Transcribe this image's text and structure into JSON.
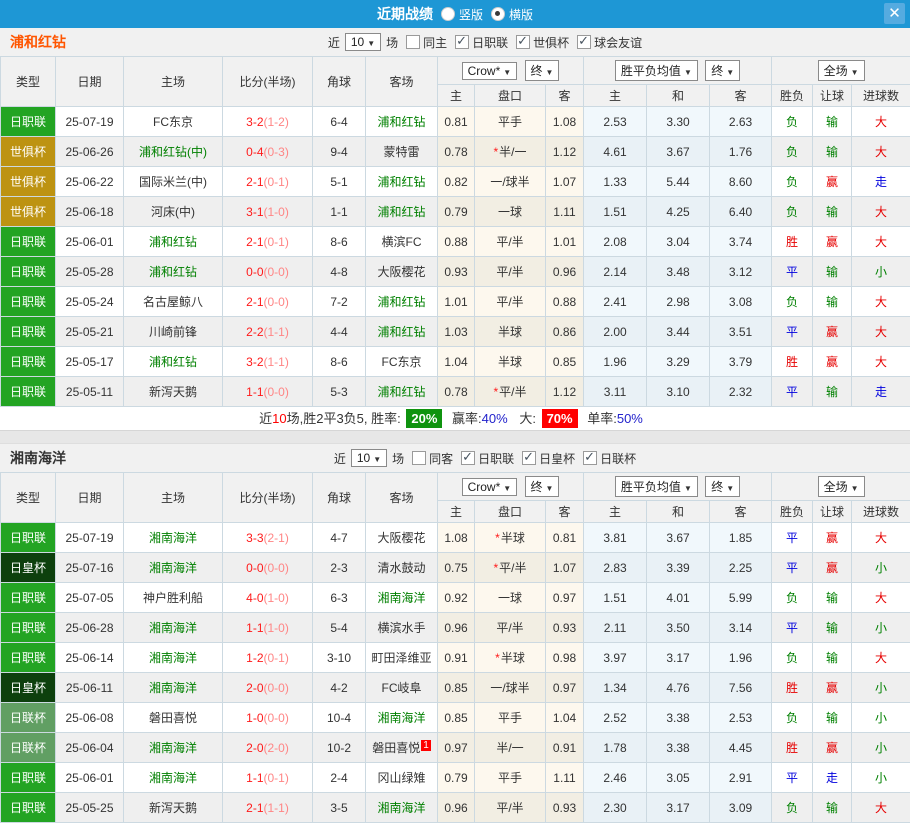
{
  "titlebar": {
    "title": "近期战绩",
    "radio_vertical": "竖版",
    "radio_horizontal": "横版",
    "close_label": "✕"
  },
  "table_header": {
    "cols": [
      "类型",
      "日期",
      "主场",
      "比分(半场)",
      "角球",
      "客场"
    ],
    "odds_dropdown": "Crow*",
    "final_dropdown": "终",
    "avg_dropdown": "胜平负均值",
    "avg_final_dropdown": "终",
    "scope_dropdown": "全场",
    "sub_cols": [
      "主",
      "盘口",
      "客",
      "主",
      "和",
      "客",
      "胜负",
      "让球",
      "进球数"
    ]
  },
  "league_colors": {
    "日职联": "#23a423",
    "世俱杯": "#bd9312",
    "日皇杯": "#0d400d",
    "日联杯": "#619f63"
  },
  "result_colors": {
    "r": "#e60000",
    "g": "#008000",
    "b": "#0000dd"
  },
  "accent_colors": {
    "titlebar": "#1e97d5",
    "team1": "#ff5500",
    "team2": "#333333",
    "win_badge_bg": "#0f930f",
    "big_badge_bg": "#ff0000"
  },
  "sections": [
    {
      "team": "浦和红钻",
      "filter": {
        "near_label": "近",
        "count": "10",
        "games_label": "场",
        "same_label": "同主",
        "same_checked": false,
        "leagues": [
          {
            "label": "日职联",
            "checked": true
          },
          {
            "label": "世俱杯",
            "checked": true
          },
          {
            "label": "球会友谊",
            "checked": true
          }
        ]
      },
      "rows": [
        {
          "type": "日职联",
          "date": "25-07-19",
          "home": "FC东京",
          "home_focus": false,
          "score": "3-2",
          "half": "(1-2)",
          "corner": "6-4",
          "away": "浦和红钻",
          "away_focus": true,
          "o1": "0.81",
          "pan": "平手",
          "pan_star": false,
          "o2": "1.08",
          "a1": "2.53",
          "a2": "3.30",
          "a3": "2.63",
          "r1": "负",
          "r1c": "g",
          "r2": "输",
          "r2c": "g",
          "r3": "大",
          "r3c": "r"
        },
        {
          "type": "世俱杯",
          "date": "25-06-26",
          "home": "浦和红钻(中)",
          "home_focus": true,
          "score": "0-4",
          "half": "(0-3)",
          "corner": "9-4",
          "away": "蒙特雷",
          "away_focus": false,
          "o1": "0.78",
          "pan": "半/一",
          "pan_star": true,
          "o2": "1.12",
          "a1": "4.61",
          "a2": "3.67",
          "a3": "1.76",
          "r1": "负",
          "r1c": "g",
          "r2": "输",
          "r2c": "g",
          "r3": "大",
          "r3c": "r"
        },
        {
          "type": "世俱杯",
          "date": "25-06-22",
          "home": "国际米兰(中)",
          "home_focus": false,
          "score": "2-1",
          "half": "(0-1)",
          "corner": "5-1",
          "away": "浦和红钻",
          "away_focus": true,
          "o1": "0.82",
          "pan": "一/球半",
          "pan_star": false,
          "o2": "1.07",
          "a1": "1.33",
          "a2": "5.44",
          "a3": "8.60",
          "r1": "负",
          "r1c": "g",
          "r2": "赢",
          "r2c": "r",
          "r3": "走",
          "r3c": "b"
        },
        {
          "type": "世俱杯",
          "date": "25-06-18",
          "home": "河床(中)",
          "home_focus": false,
          "score": "3-1",
          "half": "(1-0)",
          "corner": "1-1",
          "away": "浦和红钻",
          "away_focus": true,
          "o1": "0.79",
          "pan": "一球",
          "pan_star": false,
          "o2": "1.11",
          "a1": "1.51",
          "a2": "4.25",
          "a3": "6.40",
          "r1": "负",
          "r1c": "g",
          "r2": "输",
          "r2c": "g",
          "r3": "大",
          "r3c": "r"
        },
        {
          "type": "日职联",
          "date": "25-06-01",
          "home": "浦和红钻",
          "home_focus": true,
          "score": "2-1",
          "half": "(0-1)",
          "corner": "8-6",
          "away": "横滨FC",
          "away_focus": false,
          "o1": "0.88",
          "pan": "平/半",
          "pan_star": false,
          "o2": "1.01",
          "a1": "2.08",
          "a2": "3.04",
          "a3": "3.74",
          "r1": "胜",
          "r1c": "r",
          "r2": "赢",
          "r2c": "r",
          "r3": "大",
          "r3c": "r"
        },
        {
          "type": "日职联",
          "date": "25-05-28",
          "home": "浦和红钻",
          "home_focus": true,
          "score": "0-0",
          "half": "(0-0)",
          "corner": "4-8",
          "away": "大阪樱花",
          "away_focus": false,
          "o1": "0.93",
          "pan": "平/半",
          "pan_star": false,
          "o2": "0.96",
          "a1": "2.14",
          "a2": "3.48",
          "a3": "3.12",
          "r1": "平",
          "r1c": "b",
          "r2": "输",
          "r2c": "g",
          "r3": "小",
          "r3c": "g"
        },
        {
          "type": "日职联",
          "date": "25-05-24",
          "home": "名古屋鲸八",
          "home_focus": false,
          "score": "2-1",
          "half": "(0-0)",
          "corner": "7-2",
          "away": "浦和红钻",
          "away_focus": true,
          "o1": "1.01",
          "pan": "平/半",
          "pan_star": false,
          "o2": "0.88",
          "a1": "2.41",
          "a2": "2.98",
          "a3": "3.08",
          "r1": "负",
          "r1c": "g",
          "r2": "输",
          "r2c": "g",
          "r3": "大",
          "r3c": "r"
        },
        {
          "type": "日职联",
          "date": "25-05-21",
          "home": "川崎前锋",
          "home_focus": false,
          "score": "2-2",
          "half": "(1-1)",
          "corner": "4-4",
          "away": "浦和红钻",
          "away_focus": true,
          "o1": "1.03",
          "pan": "半球",
          "pan_star": false,
          "o2": "0.86",
          "a1": "2.00",
          "a2": "3.44",
          "a3": "3.51",
          "r1": "平",
          "r1c": "b",
          "r2": "赢",
          "r2c": "r",
          "r3": "大",
          "r3c": "r"
        },
        {
          "type": "日职联",
          "date": "25-05-17",
          "home": "浦和红钻",
          "home_focus": true,
          "score": "3-2",
          "half": "(1-1)",
          "corner": "8-6",
          "away": "FC东京",
          "away_focus": false,
          "o1": "1.04",
          "pan": "半球",
          "pan_star": false,
          "o2": "0.85",
          "a1": "1.96",
          "a2": "3.29",
          "a3": "3.79",
          "r1": "胜",
          "r1c": "r",
          "r2": "赢",
          "r2c": "r",
          "r3": "大",
          "r3c": "r"
        },
        {
          "type": "日职联",
          "date": "25-05-11",
          "home": "新泻天鹅",
          "home_focus": false,
          "score": "1-1",
          "half": "(0-0)",
          "corner": "5-3",
          "away": "浦和红钻",
          "away_focus": true,
          "o1": "0.78",
          "pan": "平/半",
          "pan_star": true,
          "o2": "1.12",
          "a1": "3.11",
          "a2": "3.10",
          "a3": "2.32",
          "r1": "平",
          "r1c": "b",
          "r2": "输",
          "r2c": "g",
          "r3": "走",
          "r3c": "b"
        }
      ],
      "summary": {
        "seg1": "近",
        "count": "10",
        "seg2": "场,胜2平3负5, 胜率:",
        "win_badge": "20%",
        "seg3": "赢率:",
        "win_pct": "40%",
        "seg4": "大:",
        "big_badge": "70%",
        "seg5": "单率:",
        "single_pct": "50%"
      }
    },
    {
      "team": "湘南海洋",
      "filter": {
        "near_label": "近",
        "count": "10",
        "games_label": "场",
        "same_label": "同客",
        "same_checked": false,
        "leagues": [
          {
            "label": "日职联",
            "checked": true
          },
          {
            "label": "日皇杯",
            "checked": true
          },
          {
            "label": "日联杯",
            "checked": true
          }
        ]
      },
      "rows": [
        {
          "type": "日职联",
          "date": "25-07-19",
          "home": "湘南海洋",
          "home_focus": true,
          "score": "3-3",
          "half": "(2-1)",
          "corner": "4-7",
          "away": "大阪樱花",
          "away_focus": false,
          "o1": "1.08",
          "pan": "半球",
          "pan_star": true,
          "o2": "0.81",
          "a1": "3.81",
          "a2": "3.67",
          "a3": "1.85",
          "r1": "平",
          "r1c": "b",
          "r2": "赢",
          "r2c": "r",
          "r3": "大",
          "r3c": "r"
        },
        {
          "type": "日皇杯",
          "date": "25-07-16",
          "home": "湘南海洋",
          "home_focus": true,
          "score": "0-0",
          "half": "(0-0)",
          "corner": "2-3",
          "away": "清水鼓动",
          "away_focus": false,
          "o1": "0.75",
          "pan": "平/半",
          "pan_star": true,
          "o2": "1.07",
          "a1": "2.83",
          "a2": "3.39",
          "a3": "2.25",
          "r1": "平",
          "r1c": "b",
          "r2": "赢",
          "r2c": "r",
          "r3": "小",
          "r3c": "g"
        },
        {
          "type": "日职联",
          "date": "25-07-05",
          "home": "神户胜利船",
          "home_focus": false,
          "score": "4-0",
          "half": "(1-0)",
          "corner": "6-3",
          "away": "湘南海洋",
          "away_focus": true,
          "o1": "0.92",
          "pan": "一球",
          "pan_star": false,
          "o2": "0.97",
          "a1": "1.51",
          "a2": "4.01",
          "a3": "5.99",
          "r1": "负",
          "r1c": "g",
          "r2": "输",
          "r2c": "g",
          "r3": "大",
          "r3c": "r"
        },
        {
          "type": "日职联",
          "date": "25-06-28",
          "home": "湘南海洋",
          "home_focus": true,
          "score": "1-1",
          "half": "(1-0)",
          "corner": "5-4",
          "away": "横滨水手",
          "away_focus": false,
          "o1": "0.96",
          "pan": "平/半",
          "pan_star": false,
          "o2": "0.93",
          "a1": "2.11",
          "a2": "3.50",
          "a3": "3.14",
          "r1": "平",
          "r1c": "b",
          "r2": "输",
          "r2c": "g",
          "r3": "小",
          "r3c": "g"
        },
        {
          "type": "日职联",
          "date": "25-06-14",
          "home": "湘南海洋",
          "home_focus": true,
          "score": "1-2",
          "half": "(0-1)",
          "corner": "3-10",
          "away": "町田泽维亚",
          "away_focus": false,
          "o1": "0.91",
          "pan": "半球",
          "pan_star": true,
          "o2": "0.98",
          "a1": "3.97",
          "a2": "3.17",
          "a3": "1.96",
          "r1": "负",
          "r1c": "g",
          "r2": "输",
          "r2c": "g",
          "r3": "大",
          "r3c": "r"
        },
        {
          "type": "日皇杯",
          "date": "25-06-11",
          "home": "湘南海洋",
          "home_focus": true,
          "score": "2-0",
          "half": "(0-0)",
          "corner": "4-2",
          "away": "FC岐阜",
          "away_focus": false,
          "o1": "0.85",
          "pan": "一/球半",
          "pan_star": false,
          "o2": "0.97",
          "a1": "1.34",
          "a2": "4.76",
          "a3": "7.56",
          "r1": "胜",
          "r1c": "r",
          "r2": "赢",
          "r2c": "r",
          "r3": "小",
          "r3c": "g"
        },
        {
          "type": "日联杯",
          "date": "25-06-08",
          "home": "磐田喜悦",
          "home_focus": false,
          "score": "1-0",
          "half": "(0-0)",
          "corner": "10-4",
          "away": "湘南海洋",
          "away_focus": true,
          "o1": "0.85",
          "pan": "平手",
          "pan_star": false,
          "o2": "1.04",
          "a1": "2.52",
          "a2": "3.38",
          "a3": "2.53",
          "r1": "负",
          "r1c": "g",
          "r2": "输",
          "r2c": "g",
          "r3": "小",
          "r3c": "g"
        },
        {
          "type": "日联杯",
          "date": "25-06-04",
          "home": "湘南海洋",
          "home_focus": true,
          "score": "2-0",
          "half": "(2-0)",
          "corner": "10-2",
          "away": "磐田喜悦",
          "away_focus": false,
          "away_badge": "1",
          "o1": "0.97",
          "pan": "半/一",
          "pan_star": false,
          "o2": "0.91",
          "a1": "1.78",
          "a2": "3.38",
          "a3": "4.45",
          "r1": "胜",
          "r1c": "r",
          "r2": "赢",
          "r2c": "r",
          "r3": "小",
          "r3c": "g"
        },
        {
          "type": "日职联",
          "date": "25-06-01",
          "home": "湘南海洋",
          "home_focus": true,
          "score": "1-1",
          "half": "(0-1)",
          "corner": "2-4",
          "away": "冈山绿雉",
          "away_focus": false,
          "o1": "0.79",
          "pan": "平手",
          "pan_star": false,
          "o2": "1.11",
          "a1": "2.46",
          "a2": "3.05",
          "a3": "2.91",
          "r1": "平",
          "r1c": "b",
          "r2": "走",
          "r2c": "b",
          "r3": "小",
          "r3c": "g"
        },
        {
          "type": "日职联",
          "date": "25-05-25",
          "home": "新泻天鹅",
          "home_focus": false,
          "score": "2-1",
          "half": "(1-1)",
          "corner": "3-5",
          "away": "湘南海洋",
          "away_focus": true,
          "o1": "0.96",
          "pan": "平/半",
          "pan_star": false,
          "o2": "0.93",
          "a1": "2.30",
          "a2": "3.17",
          "a3": "3.09",
          "r1": "负",
          "r1c": "g",
          "r2": "输",
          "r2c": "g",
          "r3": "大",
          "r3c": "r"
        }
      ]
    }
  ]
}
